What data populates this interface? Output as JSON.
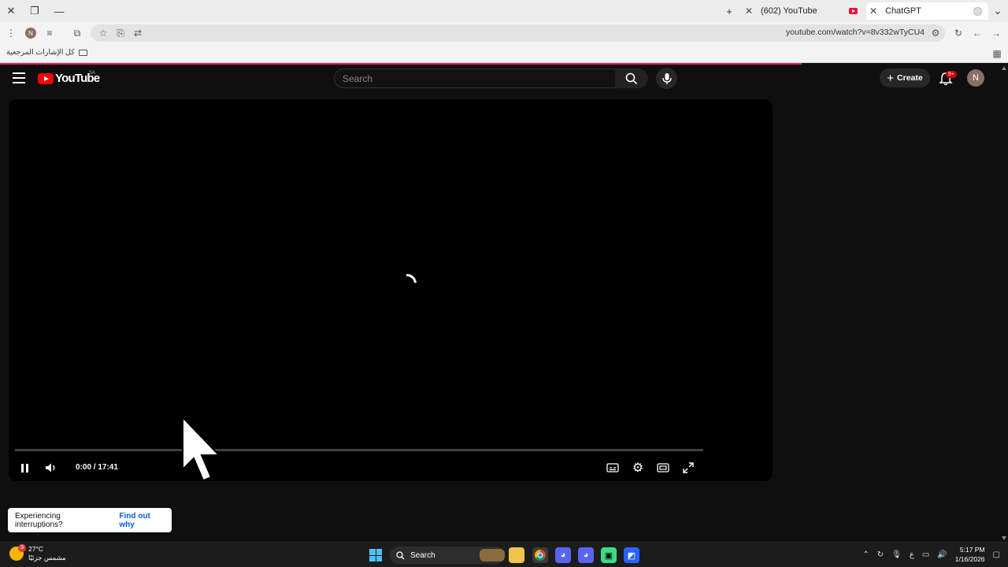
{
  "browser": {
    "tabs": [
      {
        "label": "(602) YouTube",
        "active": false
      },
      {
        "label": "ChatGPT",
        "active": true
      }
    ],
    "url": "youtube.com/watch?v=8v332wTyCU4",
    "profile_initial": "N",
    "bookmarks_label": "كل الإشارات المرجعية"
  },
  "youtube": {
    "logo_text": "YouTube",
    "country_code": "SA",
    "search_placeholder": "Search",
    "create_label": "Create",
    "notifications_badge": "9+",
    "avatar_initial": "N"
  },
  "player": {
    "time_display": "0:00 / 17:41",
    "progress_fraction": 0.0,
    "state": "loading"
  },
  "toast": {
    "message": "Experiencing interruptions?",
    "link": "Find out why"
  },
  "taskbar": {
    "weather_temp": "27°C",
    "weather_desc": "مشمس جزئيًا",
    "weather_badge": "3",
    "search_label": "Search",
    "lang": "ع",
    "time": "5:17 PM",
    "date": "1/16/2026"
  },
  "colors": {
    "accent": "#ff0000",
    "link": "#065fd4",
    "loading_bar": "#e91e63"
  }
}
